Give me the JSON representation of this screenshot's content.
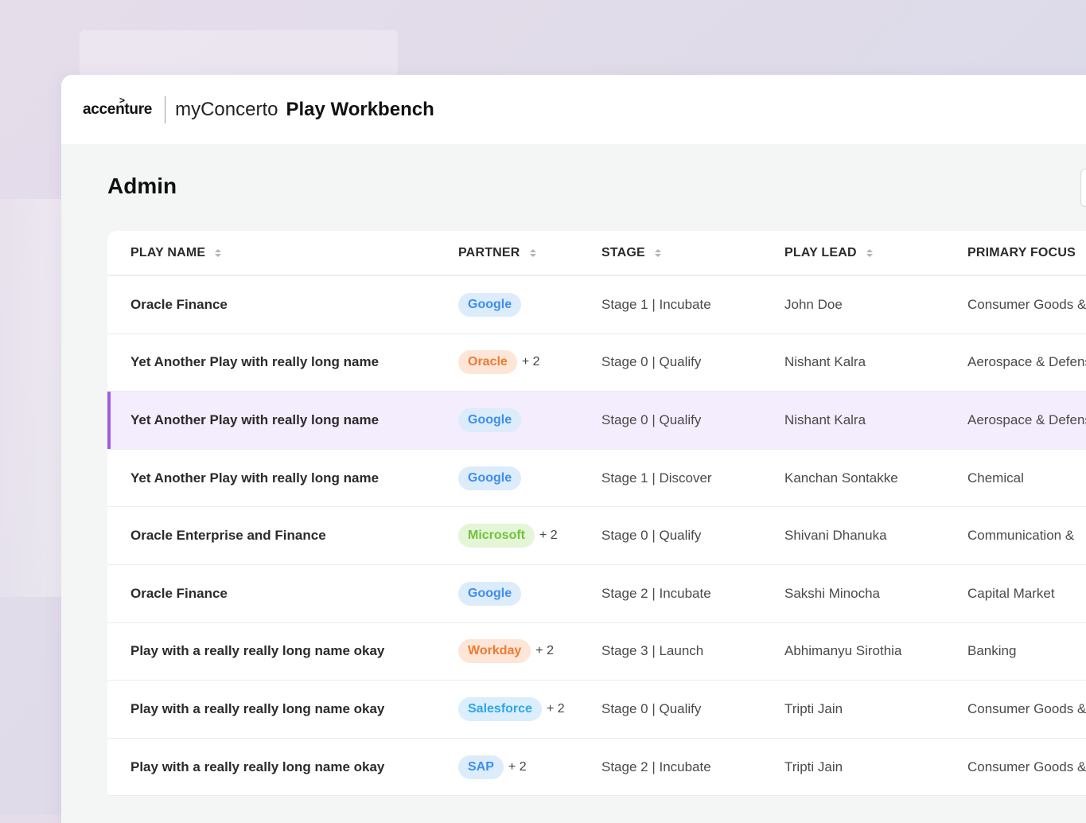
{
  "header": {
    "logo_text": "accenture",
    "logo_mark": ">",
    "app_name": "myConcerto",
    "product_name": "Play Workbench"
  },
  "page": {
    "title": "Admin"
  },
  "table": {
    "columns": [
      {
        "label": "PLAY NAME",
        "sortable": true
      },
      {
        "label": "PARTNER",
        "sortable": true
      },
      {
        "label": "STAGE",
        "sortable": true
      },
      {
        "label": "PLAY LEAD",
        "sortable": true
      },
      {
        "label": "PRIMARY FOCUS",
        "sortable": false
      }
    ],
    "rows": [
      {
        "name": "Oracle Finance",
        "partner": "Google",
        "partner_color": "#3d8ef0",
        "partner_bg": "#dcecfb",
        "extra": "",
        "stage": "Stage 1 | Incubate",
        "lead": "John Doe",
        "focus": "Consumer Goods &",
        "selected": false
      },
      {
        "name": "Yet Another Play with really long name",
        "partner": "Oracle",
        "partner_color": "#f07a30",
        "partner_bg": "#fde6d8",
        "extra": "+ 2",
        "stage": "Stage 0 | Qualify",
        "lead": "Nishant Kalra",
        "focus": "Aerospace & Defense",
        "selected": false
      },
      {
        "name": "Yet Another Play with really long name",
        "partner": "Google",
        "partner_color": "#3d8ef0",
        "partner_bg": "#dcecfb",
        "extra": "",
        "stage": "Stage 0 | Qualify",
        "lead": "Nishant Kalra",
        "focus": "Aerospace & Defense",
        "selected": true
      },
      {
        "name": "Yet Another Play with really long name",
        "partner": "Google",
        "partner_color": "#3d8ef0",
        "partner_bg": "#dcecfb",
        "extra": "",
        "stage": "Stage 1 | Discover",
        "lead": "Kanchan Sontakke",
        "focus": "Chemical",
        "selected": false
      },
      {
        "name": "Oracle Enterprise and Finance",
        "partner": "Microsoft",
        "partner_color": "#72c23a",
        "partner_bg": "#e5f5d8",
        "extra": "+ 2",
        "stage": "Stage 0 | Qualify",
        "lead": "Shivani Dhanuka",
        "focus": "Communication &",
        "selected": false
      },
      {
        "name": "Oracle Finance",
        "partner": "Google",
        "partner_color": "#3d8ef0",
        "partner_bg": "#dcecfb",
        "extra": "",
        "stage": "Stage 2 | Incubate",
        "lead": "Sakshi Minocha",
        "focus": "Capital Market",
        "selected": false
      },
      {
        "name": "Play with a really really long name okay",
        "partner": "Workday",
        "partner_color": "#f07a30",
        "partner_bg": "#fde6d8",
        "extra": "+ 2",
        "stage": "Stage 3 | Launch",
        "lead": "Abhimanyu Sirothia",
        "focus": "Banking",
        "selected": false
      },
      {
        "name": "Play with a really really long name okay",
        "partner": "Salesforce",
        "partner_color": "#2ea6e8",
        "partner_bg": "#dbeefb",
        "extra": "+ 2",
        "stage": "Stage 0 | Qualify",
        "lead": "Tripti Jain",
        "focus": "Consumer Goods &",
        "selected": false
      },
      {
        "name": "Play with a really really long name okay",
        "partner": "SAP",
        "partner_color": "#3d8ef0",
        "partner_bg": "#dcecfb",
        "extra": "+ 2",
        "stage": "Stage 2 | Incubate",
        "lead": "Tripti Jain",
        "focus": "Consumer Goods &",
        "selected": false
      }
    ]
  }
}
